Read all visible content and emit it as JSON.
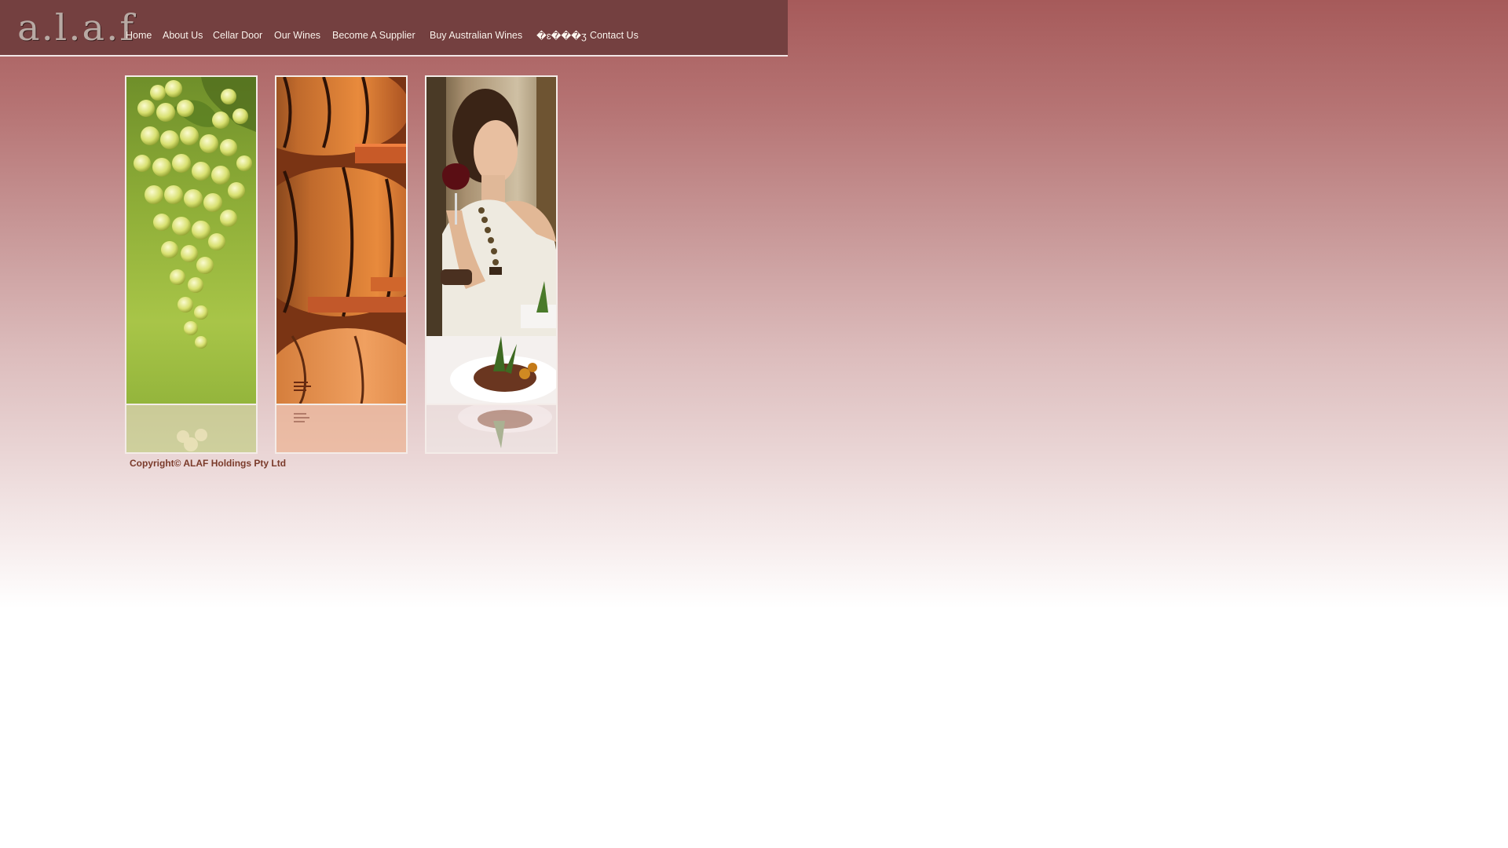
{
  "logo_text": "a.l.a.f",
  "nav": {
    "items": [
      {
        "label": "Home"
      },
      {
        "label": "About Us"
      },
      {
        "label": "Cellar Door"
      },
      {
        "label": "Our Wines"
      },
      {
        "label": "Become A Supplier"
      },
      {
        "label": "Buy Australian Wines"
      },
      {
        "label": "�ɛ���ʒ"
      },
      {
        "label": "Contact Us"
      }
    ]
  },
  "panels": [
    {
      "icon": "grapes-photo"
    },
    {
      "icon": "wine-barrels-photo"
    },
    {
      "icon": "woman-with-wine-photo"
    }
  ],
  "footer": {
    "copyright": "Copyright©  ALAF Holdings Pty Ltd"
  },
  "colors": {
    "header_bg": "#744040",
    "page_top": "#a65a5a",
    "nav_text": "#fff7f0",
    "copyright_text": "#7a3a2a"
  }
}
